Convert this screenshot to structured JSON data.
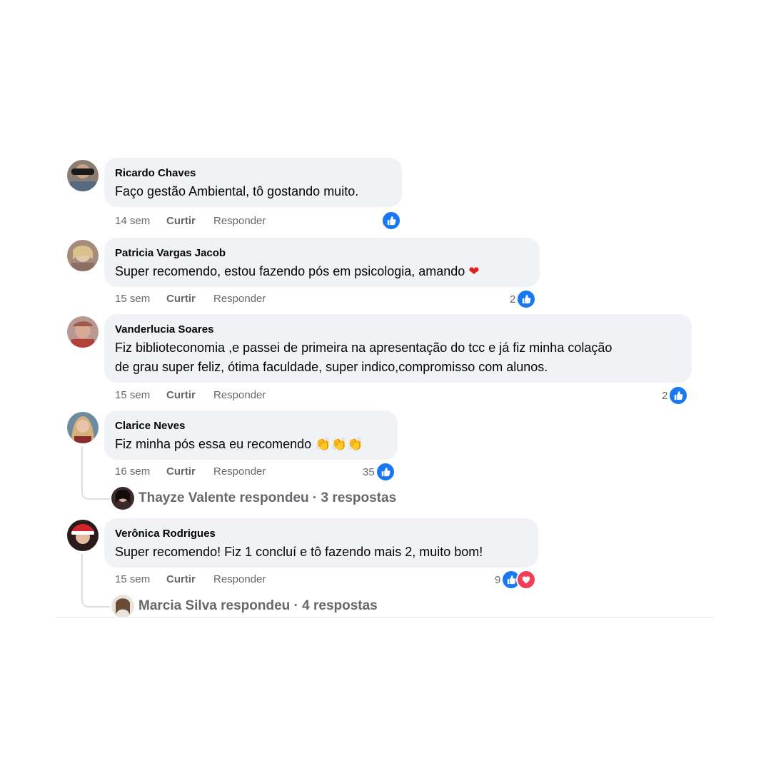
{
  "comments": [
    {
      "author": "Ricardo Chaves",
      "text": "Faço gestão Ambiental, tô gostando muito.",
      "time": "14 sem",
      "like_label": "Curtir",
      "reply_label": "Responder",
      "reaction_count": "",
      "reactions": [
        "like"
      ]
    },
    {
      "author": "Patricia Vargas Jacob",
      "text": "Super recomendo, estou fazendo pós em psicologia, amando",
      "text_emoji": "❤",
      "time": "15 sem",
      "like_label": "Curtir",
      "reply_label": "Responder",
      "reaction_count": "2",
      "reactions": [
        "like"
      ]
    },
    {
      "author": "Vanderlucia Soares",
      "text_line1": "Fiz biblioteconomia ,e passei de primeira na apresentação do tcc e já fiz minha colação",
      "text_line2": "de grau super feliz, ótima faculdade, super indico,compromisso com alunos.",
      "time": "15 sem",
      "like_label": "Curtir",
      "reply_label": "Responder",
      "reaction_count": "2",
      "reactions": [
        "like"
      ]
    },
    {
      "author": "Clarice Neves",
      "text": "Fiz minha pós essa eu recomendo",
      "text_emoji": "👏👏👏",
      "time": "16 sem",
      "like_label": "Curtir",
      "reply_label": "Responder",
      "reaction_count": "35",
      "reactions": [
        "like"
      ],
      "replies_summary": "Thayze Valente respondeu · 3 respostas"
    },
    {
      "author": "Verônica Rodrigues",
      "text": "Super recomendo! Fiz 1 concluí e tô fazendo mais 2, muito bom!",
      "time": "15 sem",
      "like_label": "Curtir",
      "reply_label": "Responder",
      "reaction_count": "9",
      "reactions": [
        "like",
        "love"
      ],
      "replies_summary": "Marcia Silva respondeu · 4 respostas"
    }
  ],
  "colors": {
    "bubble": "#f0f2f5",
    "meta_text": "#65676b",
    "like_blue": "#1877f2",
    "love_red": "#f33e58"
  }
}
